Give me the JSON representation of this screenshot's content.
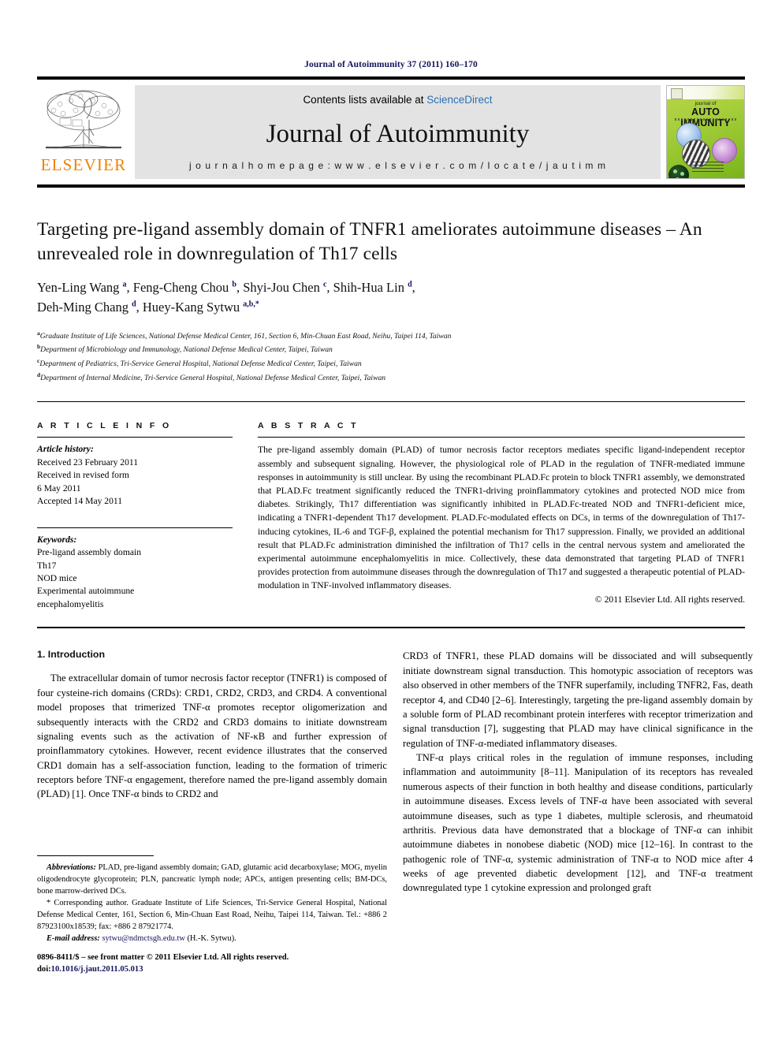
{
  "running_head": "Journal of Autoimmunity 37 (2011) 160–170",
  "masthead": {
    "publisher_logo_label": "ELSEVIER",
    "contents_prefix": "Contents lists available at ",
    "contents_link": "ScienceDirect",
    "journal_title": "Journal of Autoimmunity",
    "homepage_label": "j o u r n a l   h o m e p a g e :   w w w . e l s e v i e r . c o m / l o c a t e / j a u t i m m",
    "cover": {
      "line1": "journal of",
      "line2": "AUTO IMMUNITY"
    }
  },
  "article": {
    "title": "Targeting pre-ligand assembly domain of TNFR1 ameliorates autoimmune diseases – An unrevealed role in downregulation of Th17 cells",
    "authors_html": "Yen-Ling Wang <sup>a</sup>, Feng-Cheng Chou <sup>b</sup>, Shyi-Jou Chen <sup>c</sup>, Shih-Hua Lin <sup>d</sup>, Deh-Ming Chang <sup>d</sup>, Huey-Kang Sytwu <sup>a,b,</sup>*",
    "affiliations": [
      "Graduate Institute of Life Sciences, National Defense Medical Center, 161, Section 6, Min-Chuan East Road, Neihu, Taipei 114, Taiwan",
      "Department of Microbiology and Immunology, National Defense Medical Center, Taipei, Taiwan",
      "Department of Pediatrics, Tri-Service General Hospital, National Defense Medical Center, Taipei, Taiwan",
      "Department of Internal Medicine, Tri-Service General Hospital, National Defense Medical Center, Taipei, Taiwan"
    ],
    "affiliation_marks": [
      "a",
      "b",
      "c",
      "d"
    ]
  },
  "article_info": {
    "heading": "A R T I C L E   I N F O",
    "history_label": "Article history:",
    "history_lines": [
      "Received 23 February 2011",
      "Received in revised form",
      "6 May 2011",
      "Accepted 14 May 2011"
    ],
    "keywords_label": "Keywords:",
    "keywords": [
      "Pre-ligand assembly domain",
      "Th17",
      "NOD mice",
      "Experimental autoimmune",
      "encephalomyelitis"
    ]
  },
  "abstract": {
    "heading": "A B S T R A C T",
    "text": "The pre-ligand assembly domain (PLAD) of tumor necrosis factor receptors mediates specific ligand-independent receptor assembly and subsequent signaling. However, the physiological role of PLAD in the regulation of TNFR-mediated immune responses in autoimmunity is still unclear. By using the recombinant PLAD.Fc protein to block TNFR1 assembly, we demonstrated that PLAD.Fc treatment significantly reduced the TNFR1-driving proinflammatory cytokines and protected NOD mice from diabetes. Strikingly, Th17 differentiation was significantly inhibited in PLAD.Fc-treated NOD and TNFR1-deficient mice, indicating a TNFR1-dependent Th17 development. PLAD.Fc-modulated effects on DCs, in terms of the downregulation of Th17-inducing cytokines, IL-6 and TGF-β, explained the potential mechanism for Th17 suppression. Finally, we provided an additional result that PLAD.Fc administration diminished the infiltration of Th17 cells in the central nervous system and ameliorated the experimental autoimmune encephalomyelitis in mice. Collectively, these data demonstrated that targeting PLAD of TNFR1 provides protection from autoimmune diseases through the downregulation of Th17 and suggested a therapeutic potential of PLAD-modulation in TNF-involved inflammatory diseases.",
    "copyright": "© 2011 Elsevier Ltd. All rights reserved."
  },
  "body": {
    "section_number_title": "1. Introduction",
    "left_paragraph_1": "The extracellular domain of tumor necrosis factor receptor (TNFR1) is composed of four cysteine-rich domains (CRDs): CRD1, CRD2, CRD3, and CRD4. A conventional model proposes that trimerized TNF-α promotes receptor oligomerization and subsequently interacts with the CRD2 and CRD3 domains to initiate downstream signaling events such as the activation of NF-κB and further expression of proinflammatory cytokines. However, recent evidence illustrates that the conserved CRD1 domain has a self-association function, leading to the formation of trimeric receptors before TNF-α engagement, therefore named the pre-ligand assembly domain (PLAD) [1]. Once TNF-α binds to CRD2 and",
    "right_paragraph_1": "CRD3 of TNFR1, these PLAD domains will be dissociated and will subsequently initiate downstream signal transduction. This homotypic association of receptors was also observed in other members of the TNFR superfamily, including TNFR2, Fas, death receptor 4, and CD40 [2–6]. Interestingly, targeting the pre-ligand assembly domain by a soluble form of PLAD recombinant protein interferes with receptor trimerization and signal transduction [7], suggesting that PLAD may have clinical significance in the regulation of TNF-α-mediated inflammatory diseases.",
    "right_paragraph_2": "TNF-α plays critical roles in the regulation of immune responses, including inflammation and autoimmunity [8–11]. Manipulation of its receptors has revealed numerous aspects of their function in both healthy and disease conditions, particularly in autoimmune diseases. Excess levels of TNF-α have been associated with several autoimmune diseases, such as type 1 diabetes, multiple sclerosis, and rheumatoid arthritis. Previous data have demonstrated that a blockage of TNF-α can inhibit autoimmune diabetes in nonobese diabetic (NOD) mice [12–16]. In contrast to the pathogenic role of TNF-α, systemic administration of TNF-α to NOD mice after 4 weeks of age prevented diabetic development [12], and TNF-α treatment downregulated type 1 cytokine expression and prolonged graft"
  },
  "footnotes": {
    "abbrev_label": "Abbreviations:",
    "abbrev_text": " PLAD, pre-ligand assembly domain; GAD, glutamic acid decarboxylase; MOG, myelin oligodendrocyte glycoprotein; PLN, pancreatic lymph node; APCs, antigen presenting cells; BM-DCs, bone marrow-derived DCs.",
    "corresponding_text": "* Corresponding author. Graduate Institute of Life Sciences, Tri-Service General Hospital, National Defense Medical Center, 161, Section 6, Min-Chuan East Road, Neihu, Taipei 114, Taiwan. Tel.: +886 2 87923100x18539; fax: +886 2 87921774.",
    "email_label": "E-mail address:",
    "email": "sytwu@ndmctsgh.edu.tw",
    "email_suffix": " (H.-K. Sytwu)."
  },
  "imprint": {
    "line1": "0896-8411/$ – see front matter © 2011 Elsevier Ltd. All rights reserved.",
    "doi_label": "doi:",
    "doi": "10.1016/j.jaut.2011.05.013"
  },
  "colors": {
    "link_blue": "#2b6fb5",
    "ref_navy": "#14145a",
    "elsevier_orange": "#ef8200",
    "masthead_gray": "#e3e3e3"
  }
}
